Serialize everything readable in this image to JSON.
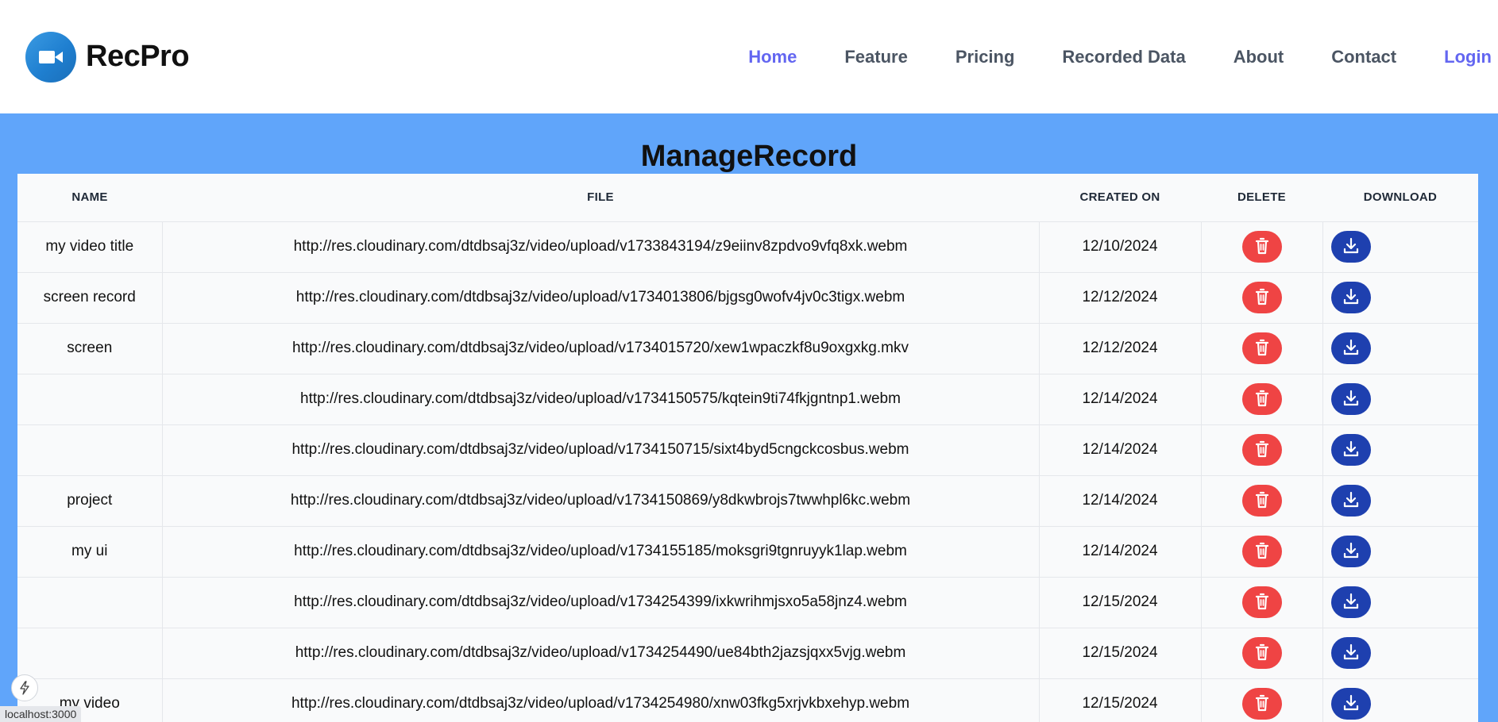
{
  "brand": {
    "name": "RecPro",
    "logo_icon": "video-camera-icon"
  },
  "nav": {
    "items": [
      {
        "label": "Home",
        "active": true
      },
      {
        "label": "Feature",
        "active": false
      },
      {
        "label": "Pricing",
        "active": false
      },
      {
        "label": "Recorded Data",
        "active": false
      },
      {
        "label": "About",
        "active": false
      },
      {
        "label": "Contact",
        "active": false
      }
    ],
    "login_label": "Login"
  },
  "page": {
    "title": "ManageRecord"
  },
  "table": {
    "headers": {
      "name": "NAME",
      "file": "FILE",
      "created_on": "CREATED ON",
      "delete": "DELETE",
      "download": "DOWNLOAD"
    },
    "rows": [
      {
        "name": "my video title",
        "file": "http://res.cloudinary.com/dtdbsaj3z/video/upload/v1733843194/z9eiinv8zpdvo9vfq8xk.webm",
        "created_on": "12/10/2024"
      },
      {
        "name": "screen record",
        "file": "http://res.cloudinary.com/dtdbsaj3z/video/upload/v1734013806/bjgsg0wofv4jv0c3tigx.webm",
        "created_on": "12/12/2024"
      },
      {
        "name": "screen",
        "file": "http://res.cloudinary.com/dtdbsaj3z/video/upload/v1734015720/xew1wpaczkf8u9oxgxkg.mkv",
        "created_on": "12/12/2024"
      },
      {
        "name": "",
        "file": "http://res.cloudinary.com/dtdbsaj3z/video/upload/v1734150575/kqtein9ti74fkjgntnp1.webm",
        "created_on": "12/14/2024"
      },
      {
        "name": "",
        "file": "http://res.cloudinary.com/dtdbsaj3z/video/upload/v1734150715/sixt4byd5cngckcosbus.webm",
        "created_on": "12/14/2024"
      },
      {
        "name": "project",
        "file": "http://res.cloudinary.com/dtdbsaj3z/video/upload/v1734150869/y8dkwbrojs7twwhpl6kc.webm",
        "created_on": "12/14/2024"
      },
      {
        "name": "my ui",
        "file": "http://res.cloudinary.com/dtdbsaj3z/video/upload/v1734155185/moksgri9tgnruyyk1lap.webm",
        "created_on": "12/14/2024"
      },
      {
        "name": "",
        "file": "http://res.cloudinary.com/dtdbsaj3z/video/upload/v1734254399/ixkwrihmjsxo5a58jnz4.webm",
        "created_on": "12/15/2024"
      },
      {
        "name": "",
        "file": "http://res.cloudinary.com/dtdbsaj3z/video/upload/v1734254490/ue84bth2jazsjqxx5vjg.webm",
        "created_on": "12/15/2024"
      },
      {
        "name": "my video",
        "file": "http://res.cloudinary.com/dtdbsaj3z/video/upload/v1734254980/xnw03fkg5xrjvkbxehyp.webm",
        "created_on": "12/15/2024"
      }
    ],
    "delete_icon": "trash-icon",
    "download_icon": "download-icon"
  },
  "status_bar": {
    "url": "localhost:3000"
  },
  "colors": {
    "accent": "#6366f1",
    "content_bg": "#60a5fa",
    "delete": "#ef4444",
    "download": "#1e40af"
  }
}
